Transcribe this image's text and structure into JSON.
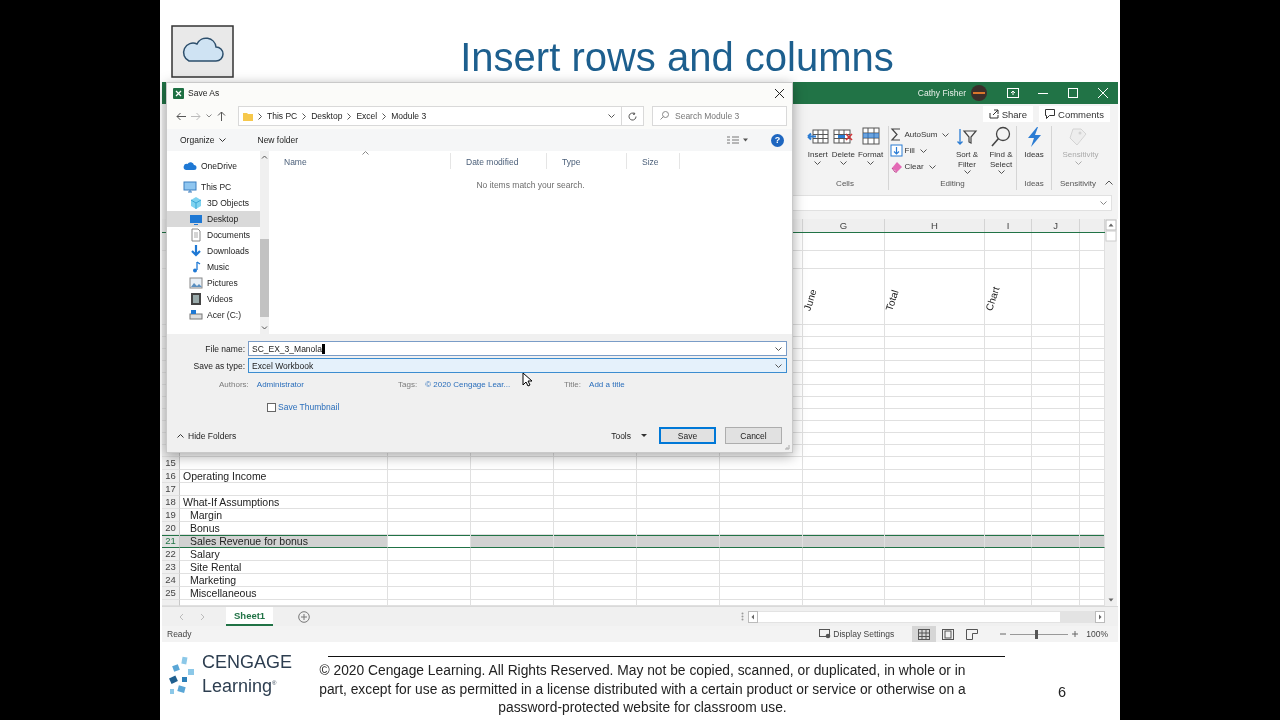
{
  "slide": {
    "title": "Insert rows and columns",
    "page_number": "6"
  },
  "excel": {
    "user": "Cathy Fisher",
    "share": "Share",
    "comments": "Comments",
    "ribbon_groups": [
      {
        "label": "Cells",
        "commands": [
          {
            "label": "Insert",
            "kind": "large",
            "menu": true,
            "disabled": false
          },
          {
            "label": "Delete",
            "kind": "large",
            "menu": true,
            "disabled": false
          },
          {
            "label": "Format",
            "kind": "large",
            "menu": true,
            "disabled": false
          }
        ]
      },
      {
        "label": "Editing",
        "commands": [
          {
            "label": "AutoSum",
            "kind": "small",
            "menu": true,
            "disabled": false
          },
          {
            "label": "Fill",
            "kind": "small",
            "menu": true,
            "disabled": false
          },
          {
            "label": "Clear",
            "kind": "small",
            "menu": true,
            "disabled": false
          },
          {
            "label": "Sort & Filter",
            "kind": "large",
            "menu": true,
            "disabled": false
          },
          {
            "label": "Find & Select",
            "kind": "large",
            "menu": true,
            "disabled": false
          }
        ]
      },
      {
        "label": "Ideas",
        "commands": [
          {
            "label": "Ideas",
            "kind": "large",
            "menu": false,
            "disabled": false
          }
        ]
      },
      {
        "label": "Sensitivity",
        "commands": [
          {
            "label": "Sensitivity",
            "kind": "large",
            "menu": true,
            "disabled": true
          }
        ]
      }
    ],
    "columns": [
      {
        "letter": "G",
        "rotated_header": "June"
      },
      {
        "letter": "H",
        "rotated_header": "Total"
      },
      {
        "letter": "I",
        "rotated_header": "Chart"
      },
      {
        "letter": "J"
      }
    ],
    "rows": [
      {
        "number": "15",
        "selected": false
      },
      {
        "number": "16",
        "label": "Operating Income",
        "kind": "heading",
        "selected": false
      },
      {
        "number": "17",
        "selected": false
      },
      {
        "number": "18",
        "label": "What-If Assumptions",
        "kind": "heading",
        "selected": false
      },
      {
        "number": "19",
        "label": "Margin",
        "kind": "item",
        "selected": false
      },
      {
        "number": "20",
        "label": "Bonus",
        "kind": "item",
        "selected": false
      },
      {
        "number": "21",
        "label": "Sales Revenue for bonus",
        "kind": "item",
        "selected": true
      },
      {
        "number": "22",
        "label": "Salary",
        "kind": "item",
        "selected": false
      },
      {
        "number": "23",
        "label": "Site Rental",
        "kind": "item",
        "selected": false
      },
      {
        "number": "24",
        "label": "Marketing",
        "kind": "item",
        "selected": false
      },
      {
        "number": "25",
        "label": "Miscellaneous",
        "kind": "item",
        "selected": false
      }
    ],
    "sheets": [
      {
        "label": "Sheet1",
        "selected": true
      }
    ],
    "status": "Ready",
    "display_settings": "Display Settings",
    "views": [
      {
        "kind": "normal",
        "selected": true
      },
      {
        "kind": "page_layout",
        "selected": false
      },
      {
        "kind": "page_break",
        "selected": false
      }
    ],
    "zoom": {
      "level": 0.45,
      "reading": "100%"
    }
  },
  "dialog": {
    "title": "Save As",
    "path": [
      "This PC",
      "Desktop",
      "Excel",
      "Module 3"
    ],
    "search_placeholder": "Search Module 3",
    "organize": "Organize",
    "new_folder": "New folder",
    "help": "?",
    "nav": [
      {
        "label": "OneDrive",
        "kind": "cloud",
        "selected": false
      },
      {
        "label": "This PC",
        "kind": "computer",
        "selected": false,
        "children": [
          {
            "label": "3D Objects",
            "kind": "objects",
            "selected": false
          },
          {
            "label": "Desktop",
            "kind": "desktop",
            "selected": true
          },
          {
            "label": "Documents",
            "kind": "documents",
            "selected": false
          },
          {
            "label": "Downloads",
            "kind": "downloads",
            "selected": false
          },
          {
            "label": "Music",
            "kind": "music",
            "selected": false
          },
          {
            "label": "Pictures",
            "kind": "pictures",
            "selected": false
          },
          {
            "label": "Videos",
            "kind": "videos",
            "selected": false
          },
          {
            "label": "Acer (C:)",
            "kind": "drive",
            "selected": false
          }
        ]
      }
    ],
    "columns": [
      "Name",
      "Date modified",
      "Type",
      "Size"
    ],
    "empty_message": "No items match your search.",
    "file_name_label": "File name:",
    "file_name": "SC_EX_3_Manola",
    "type_label": "Save as type:",
    "type": "Excel Workbook",
    "meta": [
      {
        "label": "Authors:",
        "value": "Administrator"
      },
      {
        "label": "Tags:",
        "value": "© 2020 Cengage Lear..."
      },
      {
        "label": "Title:",
        "value": "Add a title"
      }
    ],
    "save_thumbnail": {
      "label": "Save Thumbnail",
      "checked": false
    },
    "hide_folders": "Hide Folders",
    "tools": "Tools",
    "save": "Save",
    "cancel": "Cancel"
  },
  "footer": {
    "logo_top": "CENGAGE",
    "logo_bottom": "Learning$^{®}$",
    "copyright": "© 2020 Cengage Learning. All Rights Reserved. May not be copied, scanned, or duplicated, in whole or in part, except for use as permitted in a license distributed with a certain product or service or otherwise on a password-protected website for classroom use."
  }
}
